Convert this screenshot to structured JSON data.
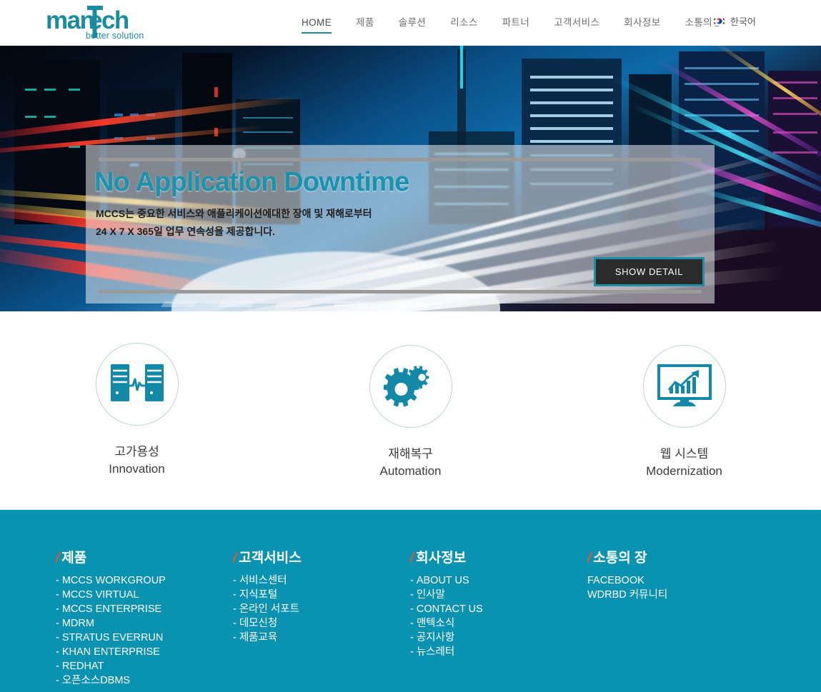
{
  "header": {
    "logo_main": "manTech",
    "logo_tag": "better solution",
    "nav": [
      {
        "label": "HOME",
        "active": true
      },
      {
        "label": "제품",
        "active": false
      },
      {
        "label": "솔루션",
        "active": false
      },
      {
        "label": "리소스",
        "active": false
      },
      {
        "label": "파트너",
        "active": false
      },
      {
        "label": "고객서비스",
        "active": false
      },
      {
        "label": "회사정보",
        "active": false
      },
      {
        "label": "소통의장",
        "active": false
      }
    ],
    "language": "한국어",
    "flag_icon": "korea-flag-icon"
  },
  "hero": {
    "title": "No Application Downtime",
    "sub_line1": "MCCS는 중요한 서비스와 애플리케이션에대한 장애 및 재해로부터",
    "sub_line2": "24 X 7 X 365일 업무 연속성을 제공합니다.",
    "button": "SHOW DETAIL",
    "title_color": "#1b93ae",
    "button_border_color": "#1f8fa6",
    "button_bg_color": "#2b2b2b"
  },
  "features": [
    {
      "icon": "servers-heartbeat-icon",
      "ko": "고가용성",
      "en": "Innovation"
    },
    {
      "icon": "gears-icon",
      "ko": "재해복구",
      "en": "Automation"
    },
    {
      "icon": "monitor-growth-chart-icon",
      "ko": "웹 시스템",
      "en": "Modernization"
    }
  ],
  "footer": {
    "bg_color": "#0a93b0",
    "accent_color": "#e8512d",
    "columns": [
      {
        "title": "제품",
        "links": [
          "MCCS WORKGROUP",
          "MCCS VIRTUAL",
          "MCCS ENTERPRISE",
          "MDRM",
          "STRATUS EVERRUN",
          "KHAN ENTERPRISE",
          "REDHAT",
          "오픈소스DBMS"
        ],
        "dashed": true
      },
      {
        "title": "고객서비스",
        "links": [
          "서비스센터",
          "지식포털",
          "온라인 서포트",
          "데모신청",
          "제품교육"
        ],
        "dashed": true
      },
      {
        "title": "회사정보",
        "links": [
          "ABOUT US",
          "인사말",
          "CONTACT US",
          "맨텍소식",
          "공지사항",
          "뉴스레터"
        ],
        "dashed": true
      },
      {
        "title": "소통의 장",
        "links": [
          "FACEBOOK",
          "WDRBD 커뮤니티"
        ],
        "dashed": false
      }
    ]
  }
}
